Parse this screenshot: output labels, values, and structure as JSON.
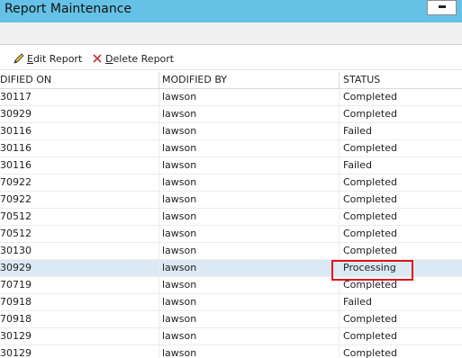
{
  "window": {
    "title": "Report Maintenance",
    "minimize_icon": "minimize-icon"
  },
  "toolbar": {
    "edit_label_accel": "E",
    "edit_label_rest": "dit Report",
    "edit_icon": "pencil-icon",
    "delete_label_accel": "D",
    "delete_label_rest": "elete Report",
    "delete_icon": "x-icon"
  },
  "table": {
    "columns": [
      "DIFIED ON",
      "MODIFIED BY",
      "STATUS"
    ],
    "rows": [
      {
        "modified_on": "30117",
        "modified_by": "lawson",
        "status": "Completed"
      },
      {
        "modified_on": "30929",
        "modified_by": "lawson",
        "status": "Completed"
      },
      {
        "modified_on": "30116",
        "modified_by": "lawson",
        "status": "Failed"
      },
      {
        "modified_on": "30116",
        "modified_by": "lawson",
        "status": "Completed"
      },
      {
        "modified_on": "30116",
        "modified_by": "lawson",
        "status": "Failed"
      },
      {
        "modified_on": "70922",
        "modified_by": "lawson",
        "status": "Completed"
      },
      {
        "modified_on": "70922",
        "modified_by": "lawson",
        "status": "Completed"
      },
      {
        "modified_on": "70512",
        "modified_by": "lawson",
        "status": "Completed"
      },
      {
        "modified_on": "70512",
        "modified_by": "lawson",
        "status": "Completed"
      },
      {
        "modified_on": "30130",
        "modified_by": "lawson",
        "status": "Completed"
      },
      {
        "modified_on": "30929",
        "modified_by": "lawson",
        "status": "Processing",
        "selected": true
      },
      {
        "modified_on": "70719",
        "modified_by": "lawson",
        "status": "Completed"
      },
      {
        "modified_on": "70918",
        "modified_by": "lawson",
        "status": "Failed"
      },
      {
        "modified_on": "70918",
        "modified_by": "lawson",
        "status": "Completed"
      },
      {
        "modified_on": "30129",
        "modified_by": "lawson",
        "status": "Completed"
      },
      {
        "modified_on": "30129",
        "modified_by": "lawson",
        "status": "Completed"
      }
    ]
  },
  "colors": {
    "titlebar": "#65c2e6",
    "selected_row": "#dbe9f4",
    "highlight_box": "#e0141b"
  }
}
